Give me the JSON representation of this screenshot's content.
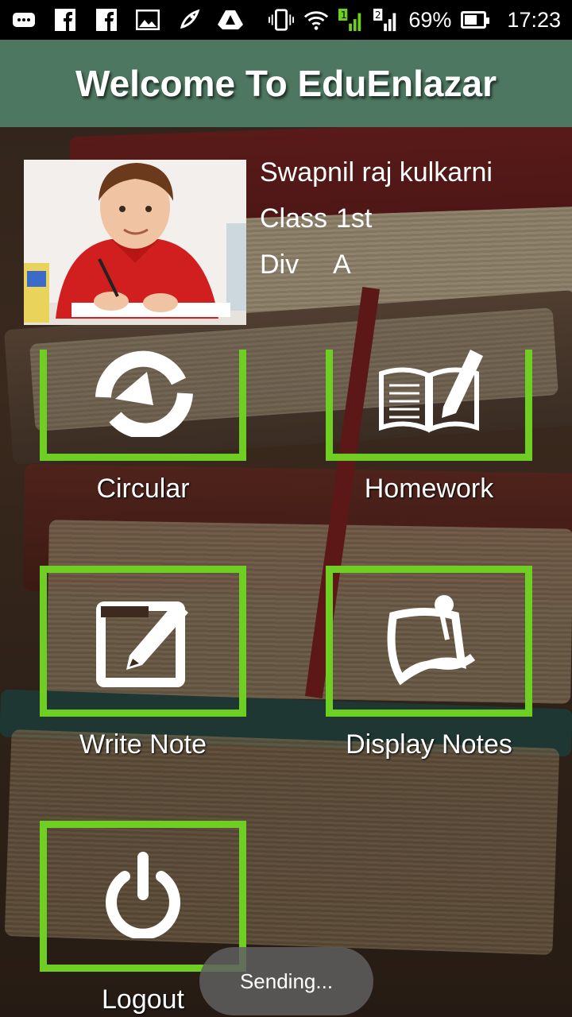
{
  "status_bar": {
    "battery": "69%",
    "time": "17:23",
    "sim1": "1",
    "sim2": "2"
  },
  "header": {
    "title": "Welcome To EduEnlazar"
  },
  "profile": {
    "name": "Swapnil raj kulkarni",
    "class_label": "Class",
    "class_value": "1st",
    "div_label": "Div",
    "div_value": "A"
  },
  "menu": {
    "circular": "Circular",
    "homework": "Homework",
    "write_note": "Write Note",
    "display_notes": "Display Notes",
    "logout": "Logout"
  },
  "toast": {
    "text": "Sending..."
  },
  "colors": {
    "header": "#4d7760",
    "tile_border": "#6fce22"
  }
}
